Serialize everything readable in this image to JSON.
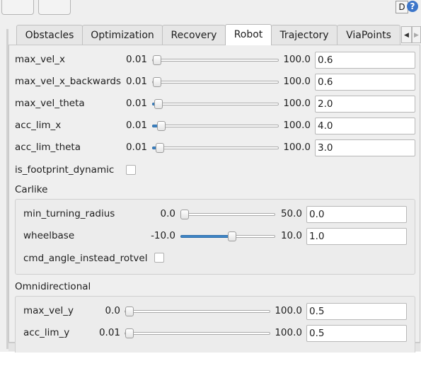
{
  "colors": {
    "accent": "#3d85c6",
    "help_icon": "#3d76c9"
  },
  "header": {
    "d_button_label": "D",
    "help_icon_glyph": "?"
  },
  "tabs": {
    "items": [
      {
        "label": "Obstacles"
      },
      {
        "label": "Optimization"
      },
      {
        "label": "Recovery"
      },
      {
        "label": "Robot",
        "active": true
      },
      {
        "label": "Trajectory"
      },
      {
        "label": "ViaPoints"
      }
    ],
    "scroll_left_icon": "chevron-left-icon",
    "scroll_right_icon": "chevron-right-icon",
    "scroll_left_glyph": "◀",
    "scroll_right_glyph": "▶"
  },
  "params": [
    {
      "name": "max_vel_x",
      "min": "0.01",
      "max": "100.0",
      "value": "0.6",
      "level": 0.006
    },
    {
      "name": "max_vel_x_backwards",
      "min": "0.01",
      "max": "100.0",
      "value": "0.6",
      "level": 0.006
    },
    {
      "name": "max_vel_theta",
      "min": "0.01",
      "max": "100.0",
      "value": "2.0",
      "level": 0.02
    },
    {
      "name": "acc_lim_x",
      "min": "0.01",
      "max": "100.0",
      "value": "4.0",
      "level": 0.04
    },
    {
      "name": "acc_lim_theta",
      "min": "0.01",
      "max": "100.0",
      "value": "3.0",
      "level": 0.03
    }
  ],
  "footprint": {
    "label": "is_footprint_dynamic",
    "checked": false
  },
  "carlike": {
    "title": "Carlike",
    "params": [
      {
        "name": "min_turning_radius",
        "min": "0.0",
        "max": "50.0",
        "value": "0.0",
        "level": 0.0
      },
      {
        "name": "wheelbase",
        "min": "-10.0",
        "max": "10.0",
        "value": "1.0",
        "level": 0.55
      }
    ],
    "checkbox": {
      "label": "cmd_angle_instead_rotvel",
      "checked": false
    }
  },
  "omni": {
    "title": "Omnidirectional",
    "params": [
      {
        "name": "max_vel_y",
        "min": "0.0",
        "max": "100.0",
        "value": "0.5",
        "level": 0.005
      },
      {
        "name": "acc_lim_y",
        "min": "0.01",
        "max": "100.0",
        "value": "0.5",
        "level": 0.005
      }
    ]
  }
}
